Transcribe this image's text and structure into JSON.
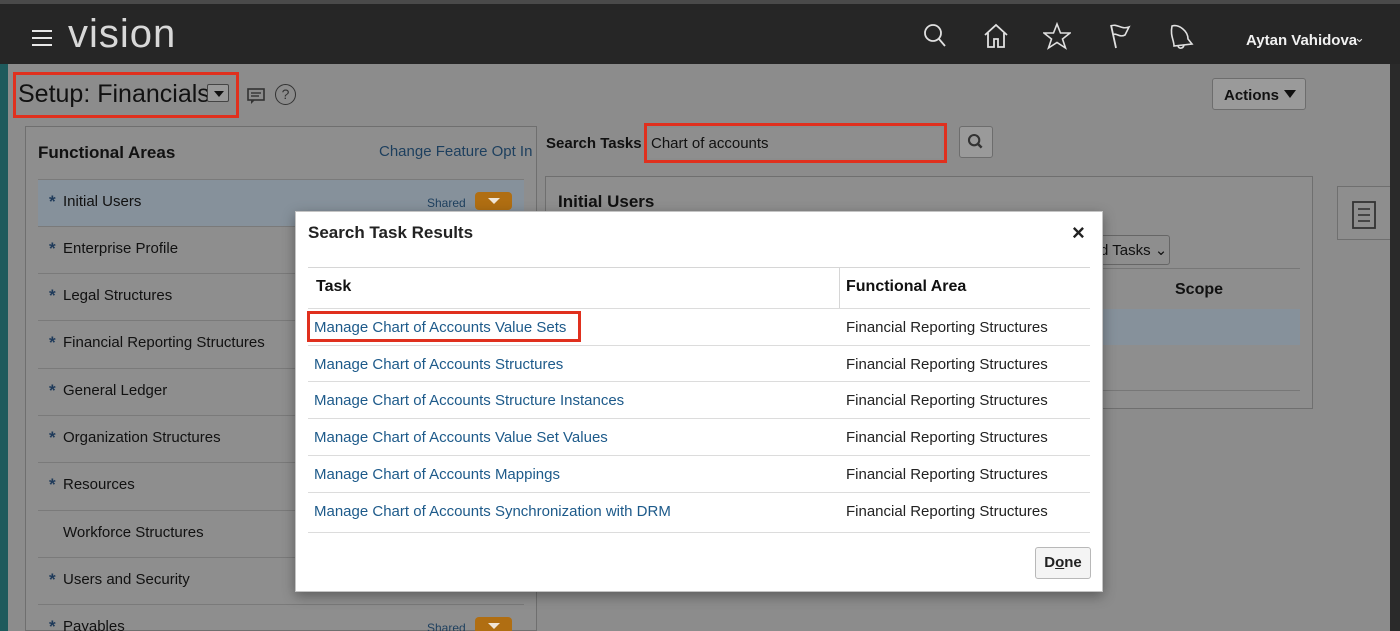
{
  "app": {
    "logo": "vision",
    "user_name": "Aytan Vahidova"
  },
  "header": {
    "page_title": "Setup: Financials",
    "actions_label": "Actions",
    "help_glyph": "?"
  },
  "functional_areas": {
    "heading": "Functional Areas",
    "change_link": "Change Feature Opt In",
    "shared_label": "Shared",
    "items": [
      {
        "label": "Initial Users",
        "required": true,
        "shared": true,
        "selected": true
      },
      {
        "label": "Enterprise Profile",
        "required": true,
        "shared": false
      },
      {
        "label": "Legal Structures",
        "required": true,
        "shared": false
      },
      {
        "label": "Financial Reporting Structures",
        "required": true,
        "shared": false
      },
      {
        "label": "General Ledger",
        "required": true,
        "shared": false
      },
      {
        "label": "Organization Structures",
        "required": true,
        "shared": false
      },
      {
        "label": "Resources",
        "required": true,
        "shared": false
      },
      {
        "label": "Workforce Structures",
        "required": false,
        "shared": false
      },
      {
        "label": "Users and Security",
        "required": true,
        "shared": false
      },
      {
        "label": "Payables",
        "required": true,
        "shared": true
      }
    ]
  },
  "search": {
    "label": "Search Tasks",
    "value": "Chart of accounts"
  },
  "content": {
    "title": "Initial Users",
    "tasks_select": "d Tasks",
    "scope_header": "Scope"
  },
  "dialog": {
    "title": "Search Task Results",
    "close_glyph": "×",
    "columns": {
      "task": "Task",
      "area": "Functional Area"
    },
    "rows": [
      {
        "task": "Manage Chart of Accounts Value Sets",
        "area": "Financial Reporting Structures"
      },
      {
        "task": "Manage Chart of Accounts Structures",
        "area": "Financial Reporting Structures"
      },
      {
        "task": "Manage Chart of Accounts Structure Instances",
        "area": "Financial Reporting Structures"
      },
      {
        "task": "Manage Chart of Accounts Value Set Values",
        "area": "Financial Reporting Structures"
      },
      {
        "task": "Manage Chart of Accounts Mappings",
        "area": "Financial Reporting Structures"
      },
      {
        "task": "Manage Chart of Accounts Synchronization with DRM",
        "area": "Financial Reporting Structures"
      }
    ],
    "done_label_prefix": "D",
    "done_label_underlined": "o",
    "done_label_suffix": "ne"
  },
  "colors": {
    "highlight": "#e0301e",
    "link": "#1d5a8a",
    "shared_button": "#b06e12"
  },
  "icons": {
    "search": "search-icon",
    "home": "home-icon",
    "favorites": "star-icon",
    "flag": "flag-icon",
    "notifications": "bell-icon",
    "menu": "hamburger-icon",
    "side_panel": "document-icon"
  }
}
